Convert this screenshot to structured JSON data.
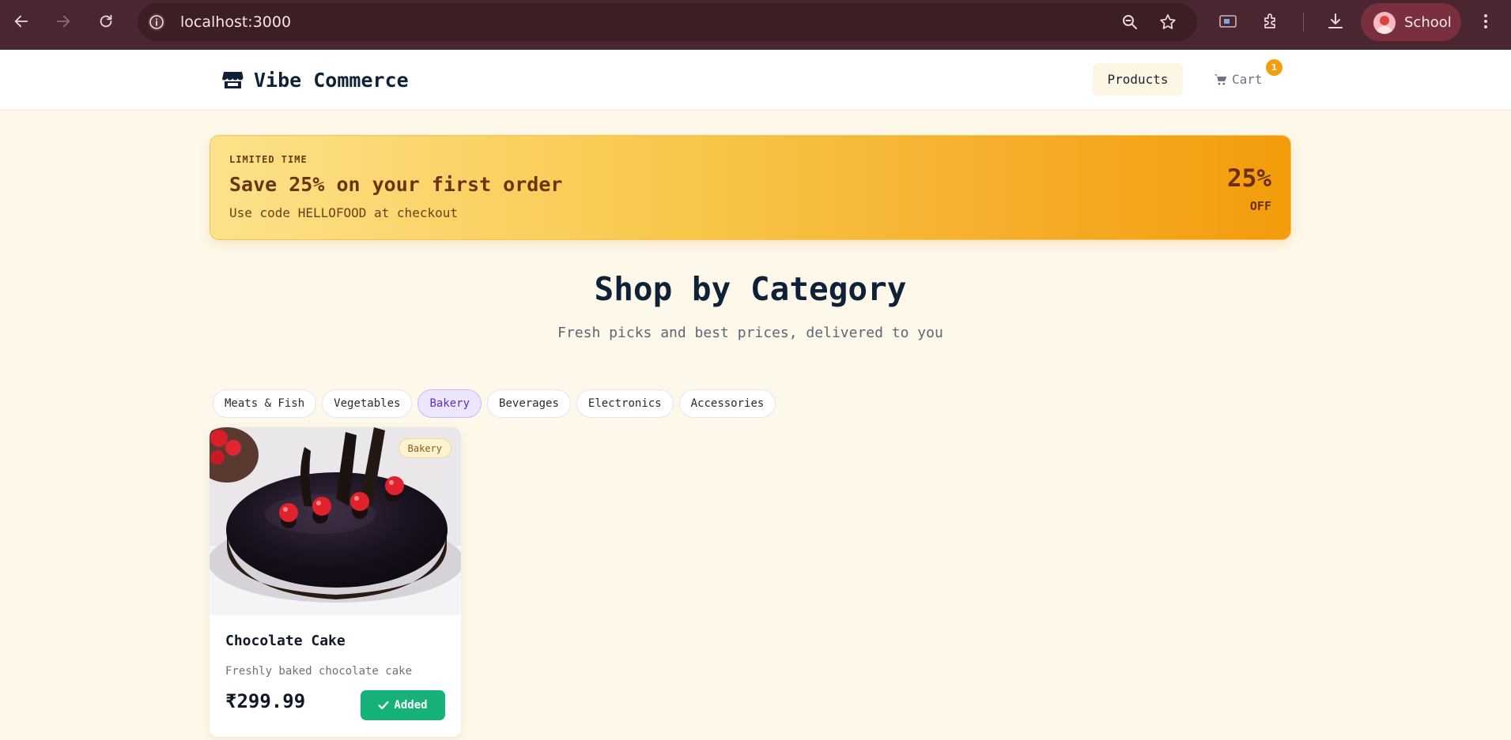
{
  "browser": {
    "url": "localhost:3000",
    "profile_label": "School"
  },
  "header": {
    "brand": "Vibe Commerce",
    "nav_products": "Products",
    "nav_cart": "Cart",
    "cart_count": "1"
  },
  "promo": {
    "eyebrow": "LIMITED TIME",
    "title": "Save 25% on your first order",
    "subtitle": "Use code HELLOFOOD at checkout",
    "percent": "25%",
    "off": "OFF"
  },
  "section": {
    "title": "Shop by Category",
    "subtitle": "Fresh picks and best prices, delivered to you"
  },
  "categories": [
    {
      "label": "Meats & Fish",
      "active": false
    },
    {
      "label": "Vegetables",
      "active": false
    },
    {
      "label": "Bakery",
      "active": true
    },
    {
      "label": "Beverages",
      "active": false
    },
    {
      "label": "Electronics",
      "active": false
    },
    {
      "label": "Accessories",
      "active": false
    }
  ],
  "products": [
    {
      "name": "Chocolate Cake",
      "description": "Freshly baked chocolate cake",
      "price": "₹299.99",
      "category_badge": "Bakery",
      "button_label": "Added"
    }
  ],
  "colors": {
    "chrome_bg": "#4a2730",
    "page_bg": "#fef8ea",
    "accent_amber": "#f59e0b",
    "added_green": "#16b27a",
    "active_pill": "#5b2fc4"
  }
}
